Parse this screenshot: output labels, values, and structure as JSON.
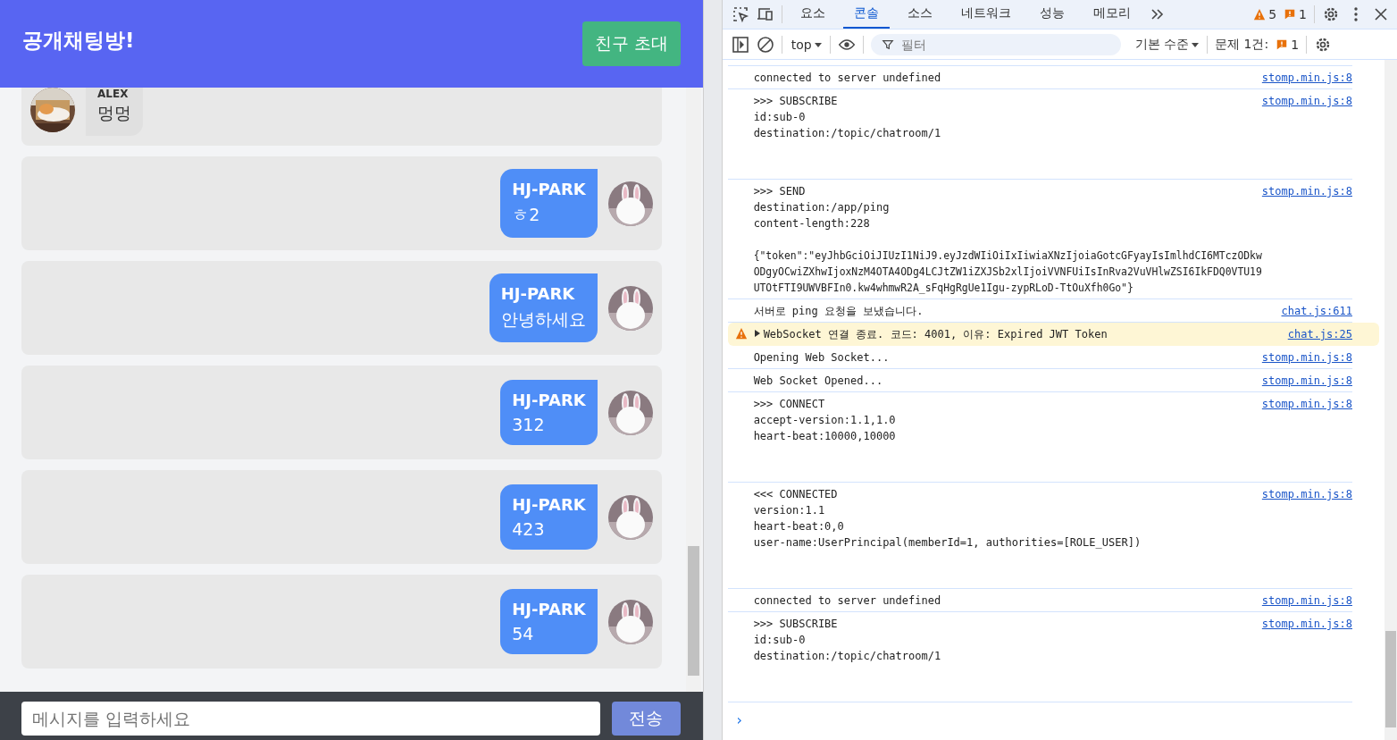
{
  "chat": {
    "title": "공개채팅방!",
    "invite_button": "친구 초대",
    "messages": [
      {
        "sender": "ALEX",
        "text": "멍멍",
        "mine": false
      },
      {
        "sender": "HJ-PARK",
        "text": "ㅎ2",
        "mine": true
      },
      {
        "sender": "HJ-PARK",
        "text": "안녕하세요",
        "mine": true
      },
      {
        "sender": "HJ-PARK",
        "text": "312",
        "mine": true
      },
      {
        "sender": "HJ-PARK",
        "text": "423",
        "mine": true
      },
      {
        "sender": "HJ-PARK",
        "text": "54",
        "mine": true
      }
    ],
    "input": {
      "placeholder": "메시지를 입력하세요"
    },
    "send_button": "전송"
  },
  "devtools": {
    "tabs": [
      {
        "label": "요소",
        "selected": false
      },
      {
        "label": "콘솔",
        "selected": true
      },
      {
        "label": "소스",
        "selected": false
      },
      {
        "label": "네트워크",
        "selected": false
      },
      {
        "label": "성능",
        "selected": false
      },
      {
        "label": "메모리",
        "selected": false
      }
    ],
    "warning_count": "5",
    "issue_count": "1",
    "context": "top",
    "filter": {
      "placeholder": "필터"
    },
    "level": "기본 수준",
    "issues": "문제 1건:",
    "issues_count": "1",
    "entries": [
      {
        "kind": "log",
        "lines": [
          "connected to server undefined"
        ],
        "source": "stomp.min.js:8"
      },
      {
        "kind": "frame",
        "lines": [
          ">>> SUBSCRIBE",
          "id:sub-0",
          "destination:/topic/chatroom/1"
        ],
        "source": "stomp.min.js:8"
      },
      {
        "kind": "log",
        "lines": [
          ">>> SEND",
          "destination:/app/ping",
          "content-length:228"
        ],
        "body": [
          "{\"token\":\"eyJhbGciOiJIUzI1NiJ9.eyJzdWIiOiIxIiwiaXNzIjoiaGotcGFyayIsImlhdCI6MTczODkw",
          "ODgyOCwiZXhwIjoxNzM4OTA4ODg4LCJtZW1iZXJSb2xlIjoiVVNFUiIsInRva2VuVHlwZSI6IkFDQ0VTU19",
          "UTOtFTI9UWVBFIn0.kw4whmwR2A_sFqHgRgUe1Igu-zypRLoD-TtOuXfh0Go\"}"
        ],
        "source": "stomp.min.js:8"
      },
      {
        "kind": "log",
        "lines": [
          "서버로 ping 요청을 보냈습니다."
        ],
        "source": "chat.js:611"
      },
      {
        "kind": "warning",
        "lines": [
          "WebSocket 연결 종료. 코드: 4001, 이유: Expired JWT Token"
        ],
        "source": "chat.js:25"
      },
      {
        "kind": "log",
        "lines": [
          "Opening Web Socket..."
        ],
        "source": "stomp.min.js:8"
      },
      {
        "kind": "log",
        "lines": [
          "Web Socket Opened..."
        ],
        "source": "stomp.min.js:8"
      },
      {
        "kind": "frame",
        "lines": [
          ">>> CONNECT",
          "accept-version:1.1,1.0",
          "heart-beat:10000,10000"
        ],
        "source": "stomp.min.js:8"
      },
      {
        "kind": "frame",
        "lines": [
          "<<< CONNECTED",
          "version:1.1",
          "heart-beat:0,0",
          "user-name:UserPrincipal(memberId=1, authorities=[ROLE_USER])"
        ],
        "source": "stomp.min.js:8"
      },
      {
        "kind": "log",
        "lines": [
          "connected to server undefined"
        ],
        "source": "stomp.min.js:8"
      },
      {
        "kind": "frame",
        "lines": [
          ">>> SUBSCRIBE",
          "id:sub-0",
          "destination:/topic/chatroom/1"
        ],
        "source": "stomp.min.js:8"
      }
    ],
    "prompt": "›"
  }
}
